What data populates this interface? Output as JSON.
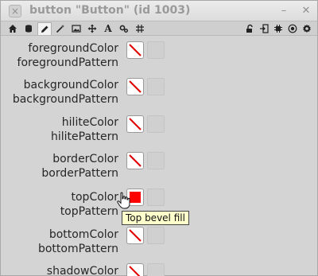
{
  "window": {
    "title": "button \"Button\" (id 1003)"
  },
  "toolbar": {
    "left_tools": [
      "home-icon",
      "database-icon",
      "pencil-icon",
      "wand-icon",
      "image-icon",
      "move-icon",
      "text-icon",
      "gears-icon",
      "grid-icon"
    ],
    "text_tool_glyph": "A",
    "right_tools": [
      "lock-icon",
      "exit-icon",
      "chip-icon",
      "target-icon",
      "gear-icon"
    ]
  },
  "properties": [
    {
      "color_label": "foregroundColor",
      "pattern_label": "foregroundPattern",
      "color": "none"
    },
    {
      "color_label": "backgroundColor",
      "pattern_label": "backgroundPattern",
      "color": "none"
    },
    {
      "color_label": "hiliteColor",
      "pattern_label": "hilitePattern",
      "color": "none"
    },
    {
      "color_label": "borderColor",
      "pattern_label": "borderPattern",
      "color": "none"
    },
    {
      "color_label": "topColor",
      "pattern_label": "topPattern",
      "color": "#ff0000"
    },
    {
      "color_label": "bottomColor",
      "pattern_label": "bottomPattern",
      "color": "none"
    },
    {
      "color_label": "shadowColor",
      "pattern_label": "",
      "color": "none"
    }
  ],
  "tooltip": {
    "text": "Top bevel fill"
  }
}
